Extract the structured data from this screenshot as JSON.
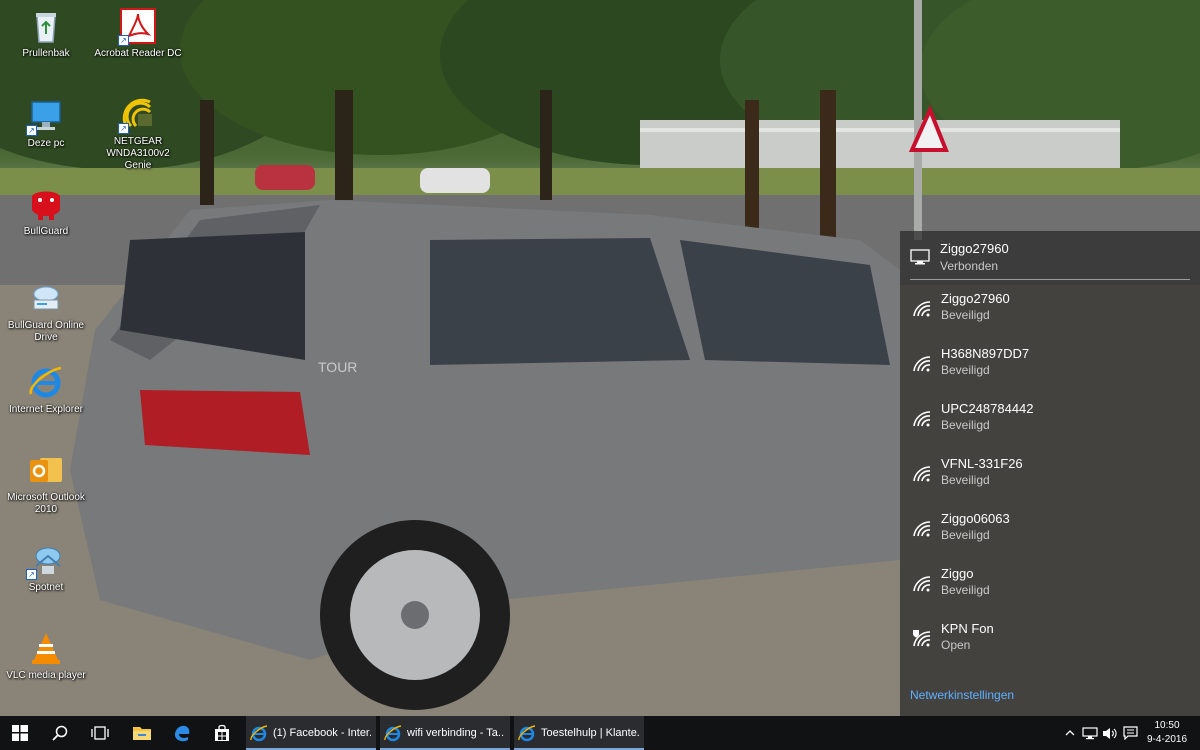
{
  "desktop": {
    "icons": [
      {
        "label": "Prullenbak",
        "icon": "recycle-bin-icon"
      },
      {
        "label": "Acrobat Reader DC",
        "icon": "acrobat-icon"
      },
      {
        "label": "Deze pc",
        "icon": "computer-icon"
      },
      {
        "label": "NETGEAR WNDA3100v2 Genie",
        "icon": "netgear-icon"
      },
      {
        "label": "BullGuard",
        "icon": "bullguard-icon"
      },
      {
        "label": "BullGuard Online Drive",
        "icon": "online-drive-icon"
      },
      {
        "label": "Internet Explorer",
        "icon": "internet-explorer-icon"
      },
      {
        "label": "Microsoft Outlook 2010",
        "icon": "outlook-icon"
      },
      {
        "label": "Spotnet",
        "icon": "spotnet-icon"
      },
      {
        "label": "VLC media player",
        "icon": "vlc-icon"
      }
    ],
    "wallpaper": {
      "car_badge": "TOUR"
    }
  },
  "network_flyout": {
    "connected": {
      "ssid": "Ziggo27960",
      "status": "Verbonden"
    },
    "networks": [
      {
        "ssid": "Ziggo27960",
        "status": "Beveiligd",
        "icon": "wifi-icon"
      },
      {
        "ssid": "H368N897DD7",
        "status": "Beveiligd",
        "icon": "wifi-icon"
      },
      {
        "ssid": "UPC248784442",
        "status": "Beveiligd",
        "icon": "wifi-icon"
      },
      {
        "ssid": "VFNL-331F26",
        "status": "Beveiligd",
        "icon": "wifi-icon"
      },
      {
        "ssid": "Ziggo06063",
        "status": "Beveiligd",
        "icon": "wifi-icon"
      },
      {
        "ssid": "Ziggo",
        "status": "Beveiligd",
        "icon": "wifi-icon"
      },
      {
        "ssid": "KPN Fon",
        "status": "Open",
        "icon": "wifi-open-shield-icon"
      }
    ],
    "settings_link": "Netwerkinstellingen",
    "link_color": "#5fb0ff"
  },
  "taskbar": {
    "buttons": [
      "start-icon",
      "search-icon",
      "task-view-icon",
      "file-explorer-icon",
      "edge-icon",
      "store-icon"
    ],
    "apps": [
      {
        "label": "(1) Facebook - Inter...",
        "icon": "internet-explorer-icon"
      },
      {
        "label": "wifi verbinding - Ta...",
        "icon": "internet-explorer-icon"
      },
      {
        "label": "Toestelhulp | Klante...",
        "icon": "internet-explorer-icon"
      }
    ],
    "tray": [
      "chevron-up-icon",
      "network-icon",
      "volume-icon",
      "action-center-icon"
    ],
    "clock": {
      "time": "10:50",
      "date": "9-4-2016"
    }
  }
}
